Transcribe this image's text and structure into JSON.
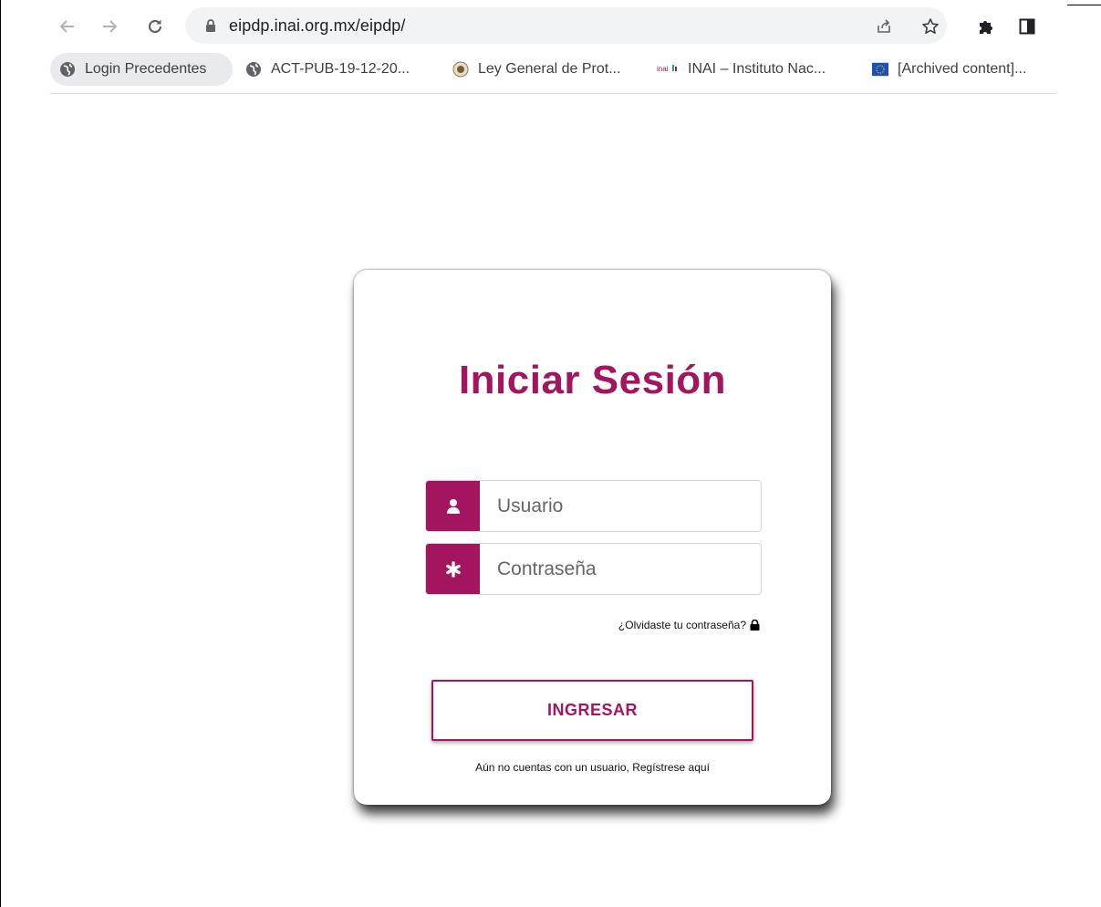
{
  "browser": {
    "url": "eipdp.inai.org.mx/eipdp/",
    "bookmarks": [
      {
        "label": "Login Precedentes",
        "icon": "globe-icon"
      },
      {
        "label": "ACT-PUB-19-12-20...",
        "icon": "globe-icon"
      },
      {
        "label": "Ley General de Prot...",
        "icon": "mexico-seal-icon"
      },
      {
        "label": "INAI – Instituto Nac...",
        "icon": "inai-logo-icon",
        "logo_text": "inai"
      },
      {
        "label": "[Archived content]...",
        "icon": "eu-flag-icon"
      }
    ]
  },
  "login": {
    "title": "Iniciar Sesión",
    "username_placeholder": "Usuario",
    "password_placeholder": "Contraseña",
    "forgot_password": "¿Olvidaste tu contraseña?",
    "submit_label": "INGRESAR",
    "register_text": "Aún no cuentas con un usuario, Regístrese aquí",
    "accent_color": "#a3155e"
  }
}
